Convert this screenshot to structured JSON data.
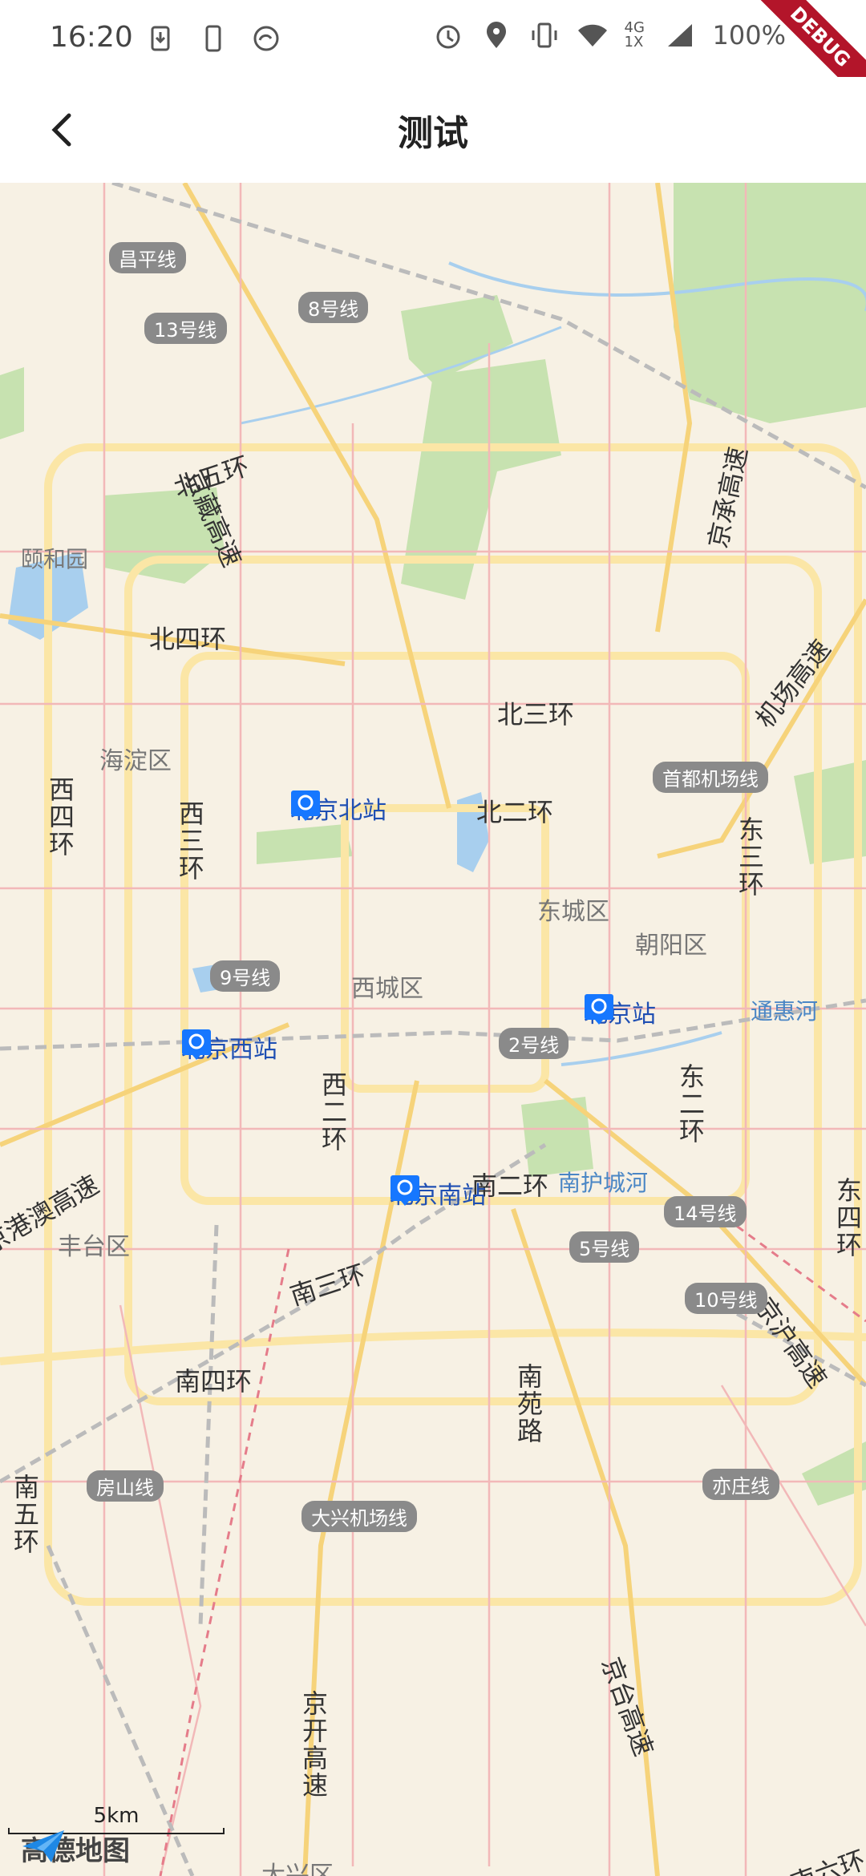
{
  "status_bar": {
    "time": "16:20",
    "network": "4G 1X",
    "battery": "100%"
  },
  "debug_banner": "DEBUG",
  "app_bar": {
    "title": "测试",
    "back_icon": "chevron-left-icon"
  },
  "map": {
    "roads": [
      {
        "label": "北五环"
      },
      {
        "label": "北四环"
      },
      {
        "label": "北三环"
      },
      {
        "label": "北二环"
      },
      {
        "label": "南二环"
      },
      {
        "label": "南三环"
      },
      {
        "label": "南四环"
      },
      {
        "label": "西四环"
      },
      {
        "label": "西三环"
      },
      {
        "label": "西二环"
      },
      {
        "label": "东二环"
      },
      {
        "label": "东三环"
      },
      {
        "label": "东四环"
      },
      {
        "label": "京藏高速"
      },
      {
        "label": "京承高速"
      },
      {
        "label": "机场高速"
      },
      {
        "label": "京沪高速"
      },
      {
        "label": "京开高速"
      },
      {
        "label": "京台高速"
      },
      {
        "label": "南苑路"
      },
      {
        "label": "南五环"
      },
      {
        "label": "南六环"
      },
      {
        "label": "京港澳高速"
      }
    ],
    "districts": [
      {
        "label": "海淀区"
      },
      {
        "label": "西城区"
      },
      {
        "label": "东城区"
      },
      {
        "label": "朝阳区"
      },
      {
        "label": "丰台区"
      },
      {
        "label": "大兴区"
      },
      {
        "label": "颐和园"
      }
    ],
    "metro_lines": [
      {
        "label": "昌平线"
      },
      {
        "label": "13号线"
      },
      {
        "label": "8号线"
      },
      {
        "label": "9号线"
      },
      {
        "label": "2号线"
      },
      {
        "label": "14号线"
      },
      {
        "label": "5号线"
      },
      {
        "label": "10号线"
      },
      {
        "label": "房山线"
      },
      {
        "label": "大兴机场线"
      },
      {
        "label": "亦庄线"
      },
      {
        "label": "首都机场线"
      }
    ],
    "stations": [
      {
        "name": "北京北站"
      },
      {
        "name": "北京西站"
      },
      {
        "name": "北京站"
      },
      {
        "name": "北京南站"
      }
    ],
    "water": [
      {
        "label": "通惠河"
      },
      {
        "label": "南护城河"
      }
    ],
    "scale": "5km",
    "brand": "高德地图"
  }
}
